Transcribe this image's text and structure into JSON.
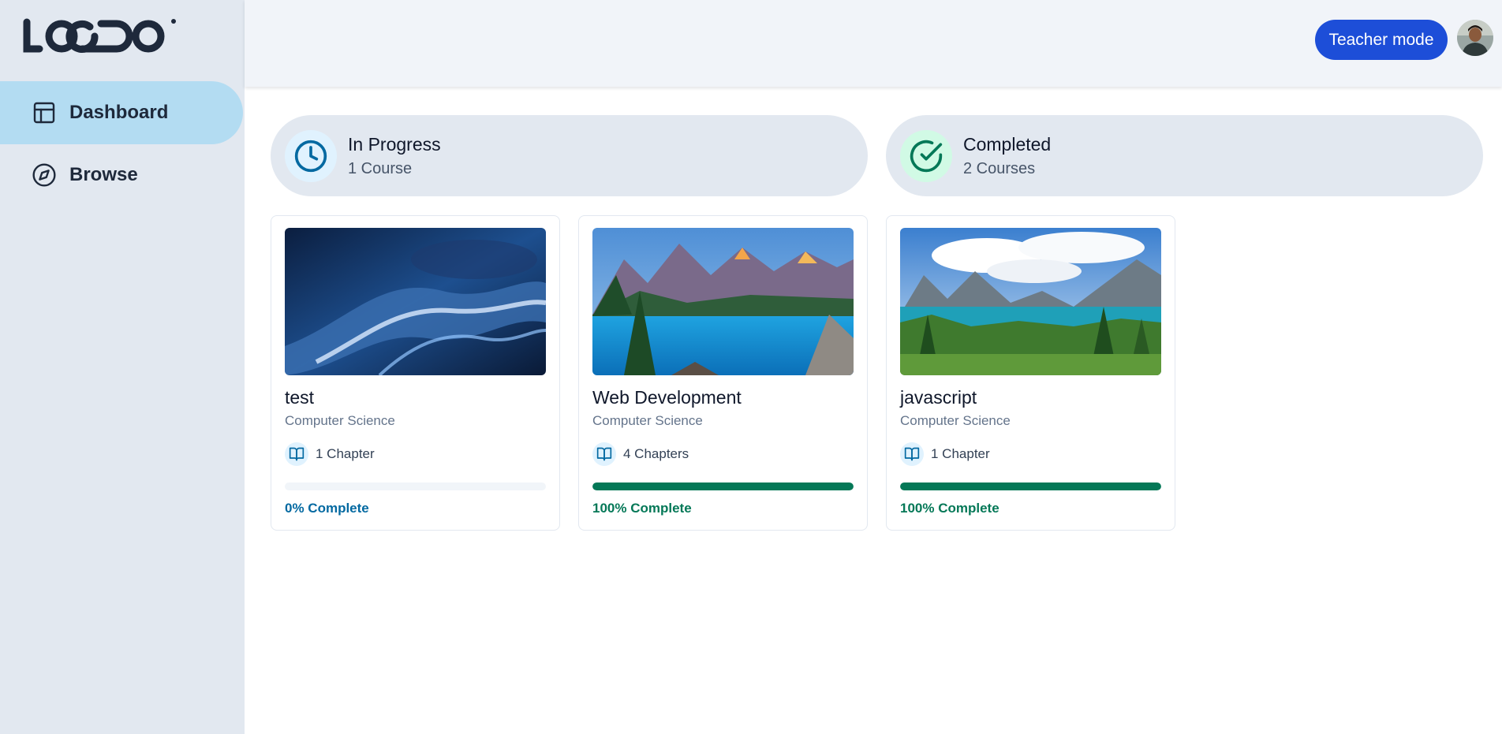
{
  "brand": {
    "logo_text": "LOGO"
  },
  "sidebar": {
    "items": [
      {
        "label": "Dashboard",
        "icon": "layout-icon",
        "active": true
      },
      {
        "label": "Browse",
        "icon": "compass-icon",
        "active": false
      }
    ]
  },
  "header": {
    "teacher_mode_label": "Teacher mode",
    "avatar": "user-avatar"
  },
  "stats": {
    "in_progress": {
      "title": "In Progress",
      "subtitle": "1 Course",
      "icon": "clock-icon",
      "color": "#0369a1"
    },
    "completed": {
      "title": "Completed",
      "subtitle": "2 Courses",
      "icon": "check-circle-icon",
      "color": "#047857"
    }
  },
  "courses": [
    {
      "title": "test",
      "category": "Computer Science",
      "chapters": "1 Chapter",
      "progress": 0,
      "progress_label": "0% Complete",
      "progress_color": "#0369a1",
      "image": "abstract-blue-liquid"
    },
    {
      "title": "Web Development",
      "category": "Computer Science",
      "chapters": "4 Chapters",
      "progress": 100,
      "progress_label": "100% Complete",
      "progress_color": "#047857",
      "image": "mountain-lake"
    },
    {
      "title": "javascript",
      "category": "Computer Science",
      "chapters": "1 Chapter",
      "progress": 100,
      "progress_label": "100% Complete",
      "progress_color": "#047857",
      "image": "alpine-lake-forest"
    }
  ]
}
